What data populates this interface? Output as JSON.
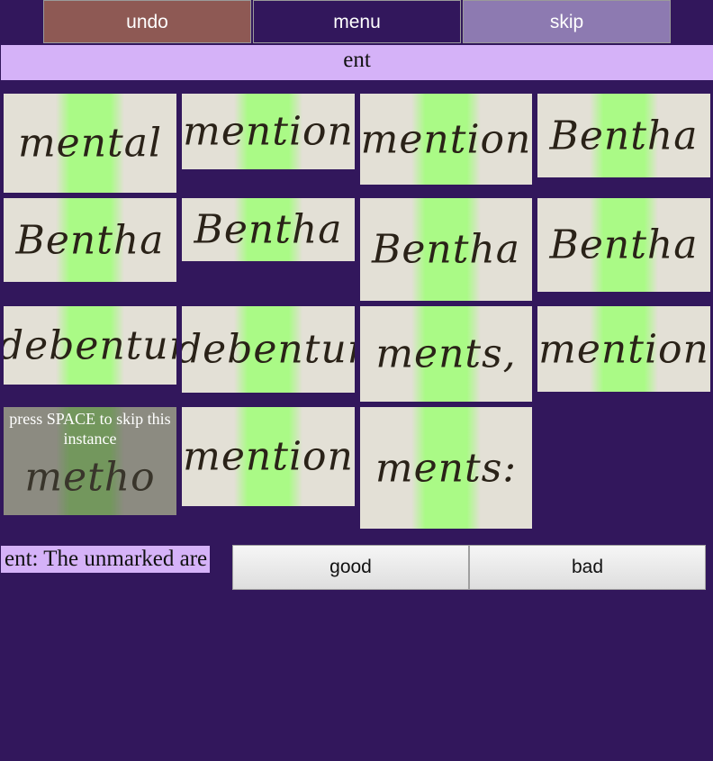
{
  "toolbar": {
    "undo_label": "undo",
    "menu_label": "menu",
    "skip_label": "skip"
  },
  "target_word": "ent",
  "tiles": [
    {
      "word": "mental"
    },
    {
      "word": "mention"
    },
    {
      "word": "mention"
    },
    {
      "word": "Bentha"
    },
    {
      "word": "Bentha"
    },
    {
      "word": "Bentha"
    },
    {
      "word": "Bentha"
    },
    {
      "word": "Bentha"
    },
    {
      "word": "debenture"
    },
    {
      "word": "debenture"
    },
    {
      "word": "ments,"
    },
    {
      "word": "mention"
    },
    {
      "word": "metho",
      "hint": "press SPACE to skip this instance"
    },
    {
      "word": "mention"
    },
    {
      "word": "ments:"
    }
  ],
  "status": {
    "text": "ent: The unmarked are"
  },
  "judgement": {
    "good_label": "good",
    "bad_label": "bad"
  },
  "colors": {
    "background": "#32175c",
    "banner": "#d5b2f8",
    "undo": "#8e5954",
    "skip": "#8d7ab1",
    "highlight": "#a0ff78"
  }
}
